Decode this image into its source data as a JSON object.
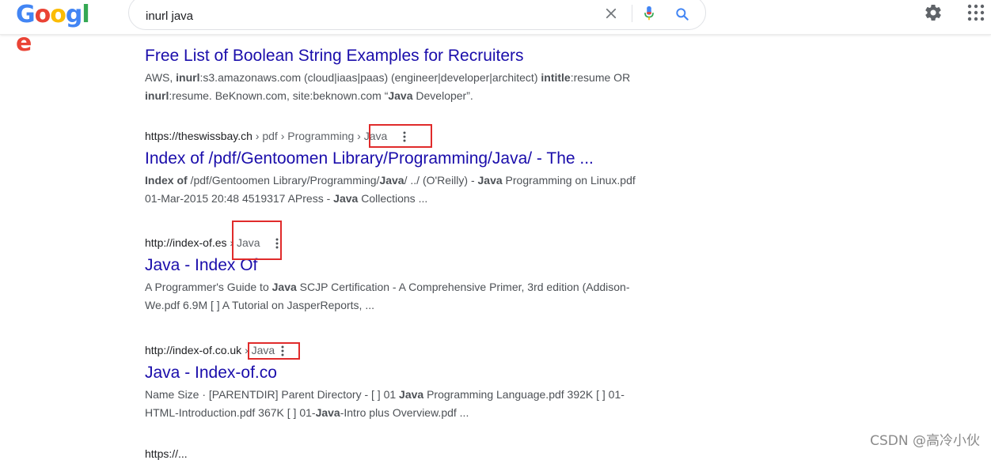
{
  "logo": {
    "letters": [
      "G",
      "o",
      "o",
      "g",
      "l",
      "e"
    ],
    "colors": [
      "#4285f4",
      "#ea4335",
      "#fbbc05",
      "#4285f4",
      "#34a853",
      "#ea4335"
    ]
  },
  "search": {
    "value": "inurl java"
  },
  "icons": {
    "clear": "close-icon",
    "mic": "mic-icon",
    "search": "search-icon",
    "settings": "gear-icon",
    "apps": "apps-grid-icon"
  },
  "results": [
    {
      "title": "Free List of Boolean String Examples for Recruiters",
      "snippet": [
        {
          "t": "AWS, "
        },
        {
          "b": "inurl"
        },
        {
          "t": ":s3.amazonaws.com (cloud|iaas|paas) (engineer|developer|architect) "
        },
        {
          "b": "intitle"
        },
        {
          "t": ":resume OR "
        },
        {
          "b": "inurl"
        },
        {
          "t": ":resume. BeKnown.com, site:beknown.com “"
        },
        {
          "b": "Java"
        },
        {
          "t": " Developer”."
        }
      ]
    },
    {
      "site": "https://theswissbay.ch",
      "crumbs": " › pdf › Programming › Java",
      "title": "Index of /pdf/Gentoomen Library/Programming/Java/ - The ...",
      "snippet": [
        {
          "b": "Index of"
        },
        {
          "t": " /pdf/Gentoomen Library/Programming/"
        },
        {
          "b": "Java"
        },
        {
          "t": "/ ../ (O'Reilly) - "
        },
        {
          "b": "Java"
        },
        {
          "t": " Programming on Linux.pdf 01-Mar-2015 20:48 4519317 APress - "
        },
        {
          "b": "Java"
        },
        {
          "t": " Collections ..."
        }
      ]
    },
    {
      "site": "http://index-of.es",
      "crumbs": " › Java",
      "title": "Java - Index Of",
      "snippet": [
        {
          "t": "A Programmer's Guide to "
        },
        {
          "b": "Java"
        },
        {
          "t": " SCJP Certification - A Comprehensive Primer, 3rd edition (Addison-We.pdf 6.9M [ ] A Tutorial on JasperReports, ..."
        }
      ]
    },
    {
      "site": "http://index-of.co.uk",
      "crumbs": " › Java",
      "title": "Java - Index-of.co",
      "snippet": [
        {
          "t": "Name Size · [PARENTDIR] Parent Directory - [ ] 01 "
        },
        {
          "b": "Java"
        },
        {
          "t": " Programming Language.pdf 392K [ ] 01-HTML-Introduction.pdf 367K [ ] 01-"
        },
        {
          "b": "Java"
        },
        {
          "t": "-Intro plus Overview.pdf ..."
        }
      ]
    }
  ],
  "next_partial": {
    "site": "https://..."
  },
  "watermark": "CSDN @高冷小伙",
  "annotation_color": "#e02b2b"
}
